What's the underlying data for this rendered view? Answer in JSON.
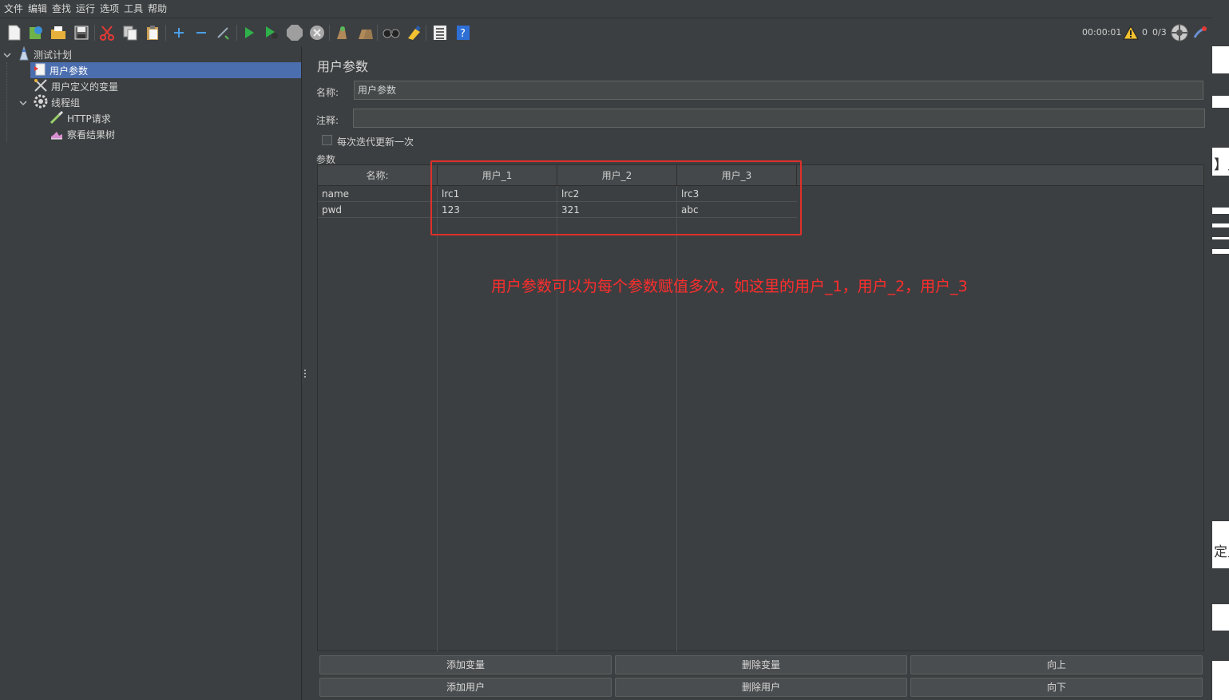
{
  "menubar": [
    "文件",
    "编辑",
    "查找",
    "运行",
    "选项",
    "工具",
    "帮助"
  ],
  "toolbar": {
    "timer": "00:00:01",
    "warning_count": "0",
    "threads": "0/3",
    "icons": [
      "new-icon",
      "templates-icon",
      "open-icon",
      "save-icon",
      "cut-icon",
      "copy-icon",
      "paste-icon",
      "expand-icon",
      "collapse-icon",
      "toggle-icon",
      "start-icon",
      "start-no-pause-icon",
      "stop-icon",
      "shutdown-icon",
      "clear-icon",
      "clear-all-icon",
      "search-icon",
      "reset-search-icon",
      "function-helper-icon",
      "help-icon"
    ]
  },
  "tree": {
    "items": [
      {
        "label": "测试计划",
        "icon": "test-plan-icon"
      },
      {
        "label": "用户参数",
        "icon": "user-params-icon",
        "selected": true
      },
      {
        "label": "用户定义的变量",
        "icon": "user-vars-icon"
      },
      {
        "label": "线程组",
        "icon": "thread-group-icon"
      },
      {
        "label": "HTTP请求",
        "icon": "http-request-icon"
      },
      {
        "label": "察看结果树",
        "icon": "results-tree-icon"
      }
    ]
  },
  "panel": {
    "title": "用户参数",
    "name_label": "名称:",
    "name_value": "用户参数",
    "comment_label": "注释:",
    "comment_value": "",
    "per_iteration_label": "每次迭代更新一次",
    "params_label": "参数"
  },
  "table": {
    "headers": [
      "名称:",
      "用户_1",
      "用户_2",
      "用户_3"
    ],
    "rows": [
      [
        "name",
        "lrc1",
        "lrc2",
        "lrc3"
      ],
      [
        "pwd",
        "123",
        "321",
        "abc"
      ]
    ]
  },
  "buttons": {
    "add_variable": "添加变量",
    "delete_variable": "删除变量",
    "move_up": "向上",
    "add_user": "添加用户",
    "delete_user": "删除用户",
    "move_down": "向下"
  },
  "annotation": {
    "text": "用户参数可以为每个参数赋值多次，如这里的用户_1，用户_2，用户_3",
    "color": "#ff2d2d"
  },
  "edge_fragments": [
    "】只",
    "定义"
  ]
}
